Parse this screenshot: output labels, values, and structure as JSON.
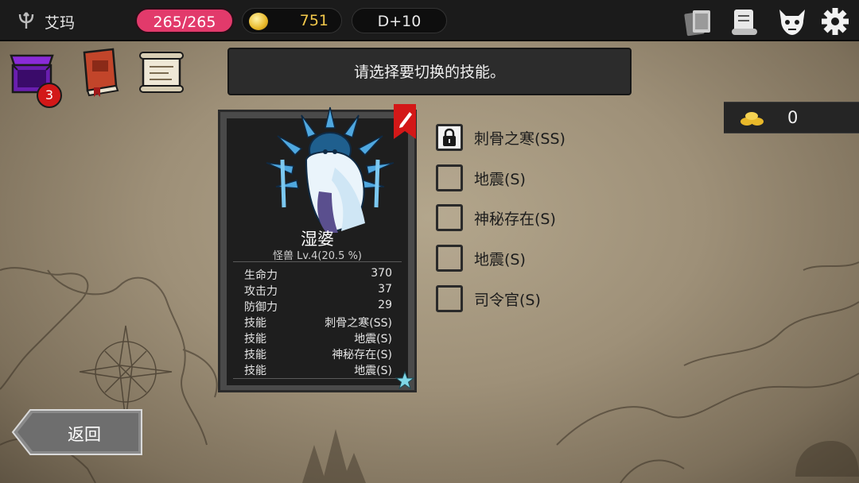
{
  "topbar": {
    "player_name": "艾玛",
    "hp": "265/265",
    "gold": "751",
    "day": "D+10",
    "icons": [
      "cards-icon",
      "scroll-map-icon",
      "demon-mask-icon",
      "gear-icon"
    ]
  },
  "left_icons": {
    "chest_badge": "3"
  },
  "message": "请选择要切换的技能。",
  "counter": {
    "value": "0"
  },
  "monster": {
    "name": "湿婆",
    "subtitle": "怪兽 Lv.4(20.5 %)",
    "stats": [
      {
        "k": "生命力",
        "v": "370"
      },
      {
        "k": "攻击力",
        "v": "37"
      },
      {
        "k": "防御力",
        "v": "29"
      },
      {
        "k": "技能",
        "v": "刺骨之寒(SS)"
      },
      {
        "k": "技能",
        "v": "地震(S)"
      },
      {
        "k": "技能",
        "v": "神秘存在(S)"
      },
      {
        "k": "技能",
        "v": "地震(S)"
      }
    ]
  },
  "skills": [
    {
      "label": "刺骨之寒(SS)",
      "locked": true
    },
    {
      "label": "地震(S)",
      "locked": false
    },
    {
      "label": "神秘存在(S)",
      "locked": false
    },
    {
      "label": "地震(S)",
      "locked": false
    },
    {
      "label": "司令官(S)",
      "locked": false
    }
  ],
  "back_label": "返回",
  "colors": {
    "hp": "#e23a6b",
    "gold_text": "#f2c84b",
    "badge": "#d31818",
    "topbar": "#1b1b1b"
  }
}
